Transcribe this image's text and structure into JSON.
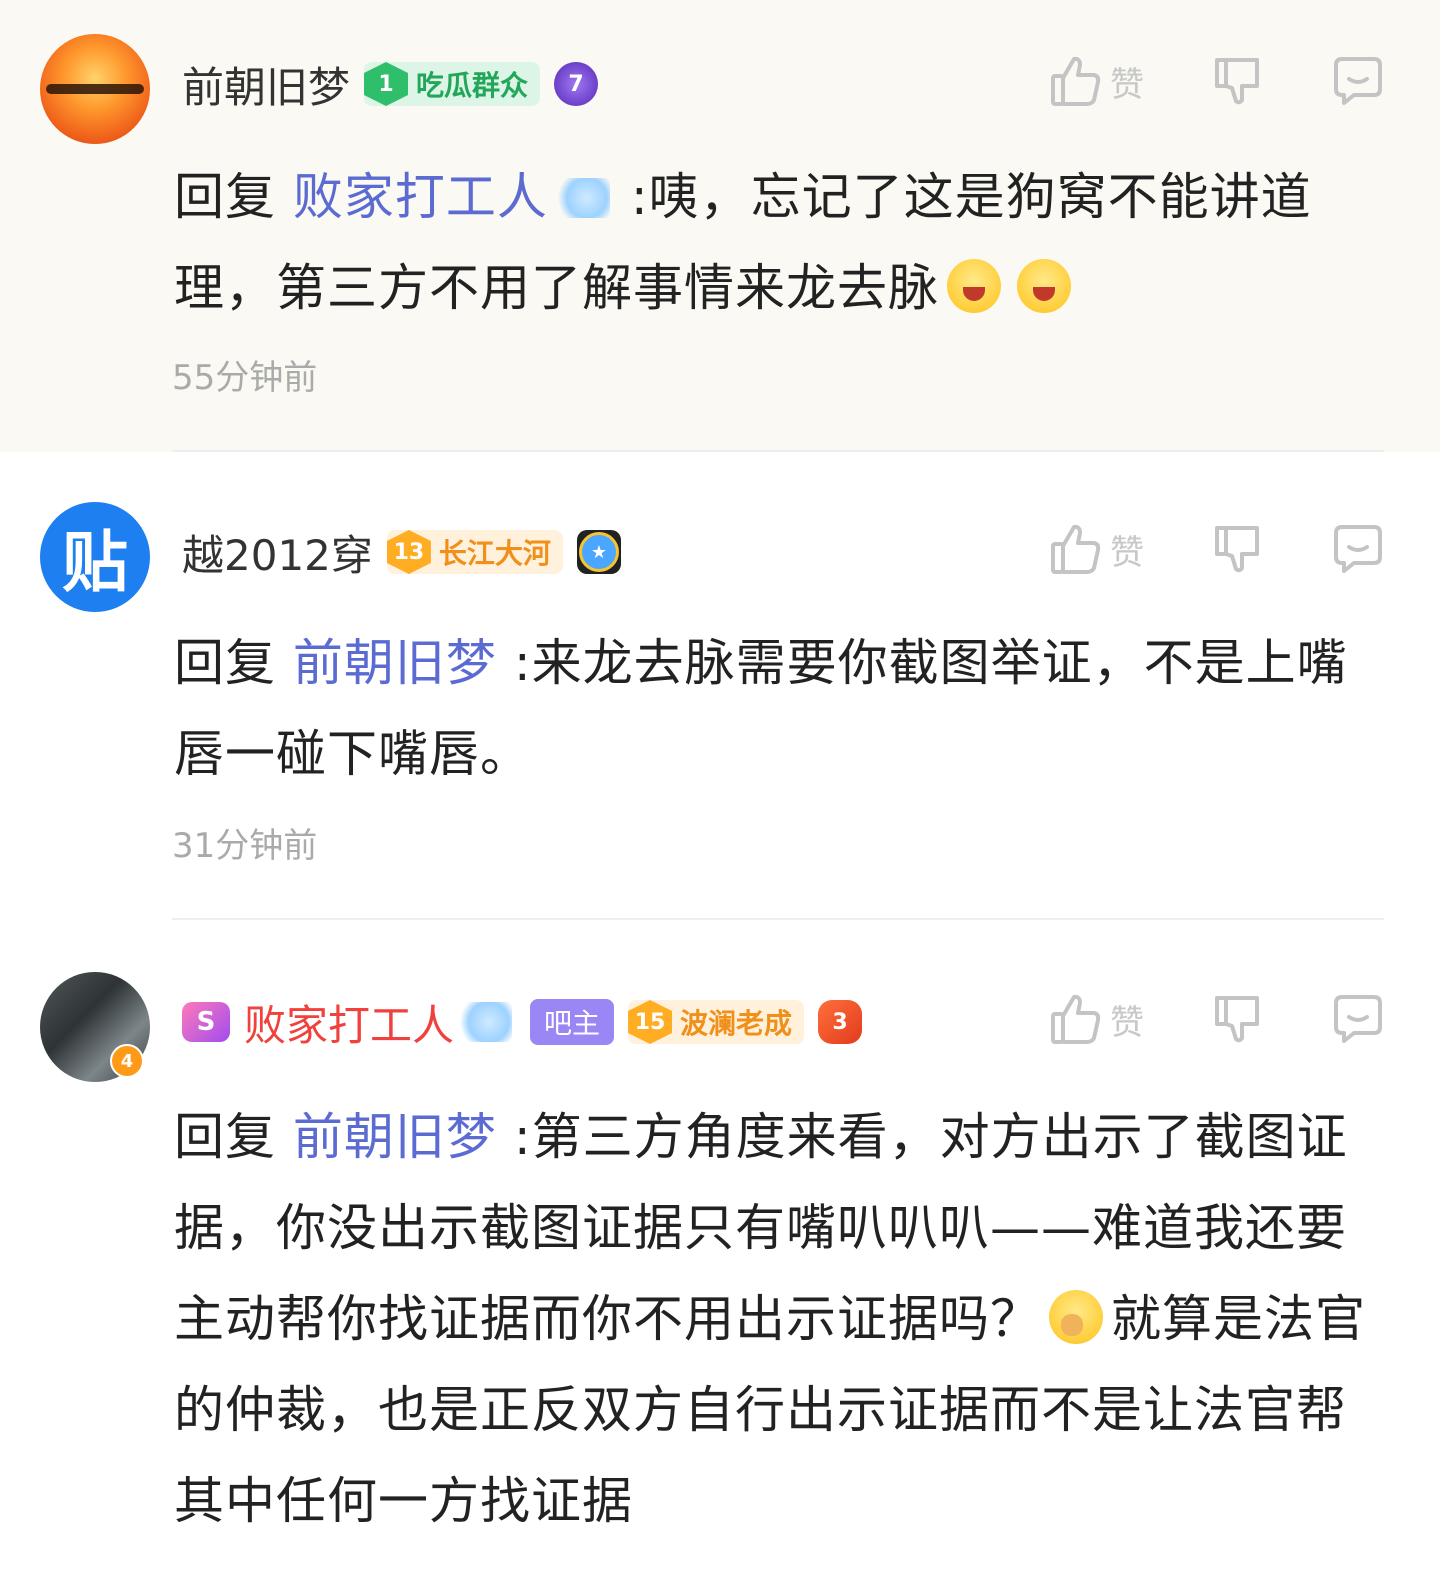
{
  "comments": [
    {
      "username": "前朝旧梦",
      "level": "1",
      "level_title": "吃瓜群众",
      "medal": "7",
      "like_label": "赞",
      "reply_prefix": "回复",
      "reply_to": "败家打工人",
      "text_part1": ":咦，忘记了这是狗窝不能讲道理，第三方不用了解事情来龙去脉",
      "timestamp": "55分钟前"
    },
    {
      "username": "越2012穿",
      "avatar_text": "贴",
      "level": "13",
      "level_title": "长江大河",
      "medal": "★",
      "like_label": "赞",
      "reply_prefix": "回复",
      "reply_to": "前朝旧梦",
      "text_part1": ":来龙去脉需要你截图举证，不是上嘴唇一碰下嘴唇。",
      "timestamp": "31分钟前"
    },
    {
      "username": "败家打工人",
      "vip": "S",
      "avatar_badge": "4",
      "role": "吧主",
      "level": "15",
      "level_title": "波澜老成",
      "medal": "3",
      "like_label": "赞",
      "reply_prefix": "回复",
      "reply_to": "前朝旧梦",
      "text_part1": ":第三方角度来看，对方出示了截图证据，你没出示截图证据只有嘴叭叭叭——难道我还要主动帮你找证据而你不用出示证据吗？",
      "text_part2": "就算是法官的仲裁，也是正反双方自行出示证据而不是让法官帮其中任何一方找证据"
    }
  ],
  "icons": {
    "like": "thumbs-up-icon",
    "dislike": "thumbs-down-icon",
    "reply": "comment-bubble-icon"
  }
}
